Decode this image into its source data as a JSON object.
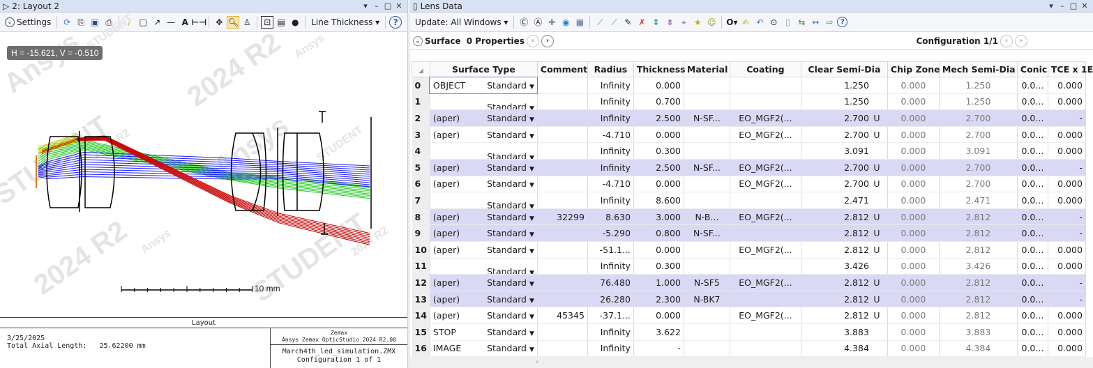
{
  "left_window": {
    "title": "2: Layout 2",
    "settings_label": "Settings",
    "line_thickness_label": "Line Thickness",
    "coord_readout": "H = -15.621, V = -0.510",
    "scale_label": "10 mm",
    "watermark_words": [
      "Ansys",
      "STUDENT",
      "2024 R2"
    ],
    "footer": {
      "title": "Layout",
      "date": "3/25/2025",
      "axial_length": "Total Axial Length:   25.62200 mm",
      "brand_line1": "Zemax",
      "brand_line2": "Ansys Zemax OpticStudio 2024 R2.00",
      "filename": "March4th_led_simulation.ZMX",
      "configuration": "Configuration 1 of 1"
    }
  },
  "right_window": {
    "title": "Lens Data",
    "update_label": "Update: All Windows",
    "surface_label": "Surface",
    "properties_label": "0 Properties",
    "configuration_label": "Configuration 1/1",
    "columns": [
      "",
      "Surface Type",
      "Comment",
      "Radius",
      "Thickness",
      "Material",
      "Coating",
      "Clear Semi-Dia",
      "Chip Zone",
      "Mech Semi-Dia",
      "Conic",
      "TCE x 1E"
    ],
    "rows": [
      {
        "idx": "0",
        "name": "OBJECT",
        "type": "Standard",
        "comment": "",
        "radius": "Infinity",
        "thickness": "0.000",
        "material": "",
        "coating": "",
        "clear": "1.250",
        "u": "",
        "chip": "0.000",
        "mech": "1.250",
        "conic": "0.0...",
        "tce": "0.000",
        "alt": false
      },
      {
        "idx": "1",
        "name": "",
        "type": "Standard",
        "comment": "",
        "radius": "Infinity",
        "thickness": "0.700",
        "material": "",
        "coating": "",
        "clear": "1.250",
        "u": "",
        "chip": "0.000",
        "mech": "1.250",
        "conic": "0.0...",
        "tce": "0.000",
        "alt": false
      },
      {
        "idx": "2",
        "name": "(aper)",
        "type": "Standard",
        "comment": "",
        "radius": "Infinity",
        "thickness": "2.500",
        "material": "N-SF...",
        "coating": "EO_MGF2(...",
        "clear": "2.700",
        "u": "U",
        "chip": "0.000",
        "mech": "2.700",
        "conic": "0.0...",
        "tce": "-",
        "alt": true
      },
      {
        "idx": "3",
        "name": "(aper)",
        "type": "Standard",
        "comment": "",
        "radius": "-4.710",
        "thickness": "0.000",
        "material": "",
        "coating": "EO_MGF2(...",
        "clear": "2.700",
        "u": "U",
        "chip": "0.000",
        "mech": "2.700",
        "conic": "0.0...",
        "tce": "0.000",
        "alt": false
      },
      {
        "idx": "4",
        "name": "",
        "type": "Standard",
        "comment": "",
        "radius": "Infinity",
        "thickness": "0.300",
        "material": "",
        "coating": "",
        "clear": "3.091",
        "u": "",
        "chip": "0.000",
        "mech": "3.091",
        "conic": "0.0...",
        "tce": "0.000",
        "alt": false
      },
      {
        "idx": "5",
        "name": "(aper)",
        "type": "Standard",
        "comment": "",
        "radius": "Infinity",
        "thickness": "2.500",
        "material": "N-SF...",
        "coating": "EO_MGF2(...",
        "clear": "2.700",
        "u": "U",
        "chip": "0.000",
        "mech": "2.700",
        "conic": "0.0...",
        "tce": "-",
        "alt": true
      },
      {
        "idx": "6",
        "name": "(aper)",
        "type": "Standard",
        "comment": "",
        "radius": "-4.710",
        "thickness": "0.000",
        "material": "",
        "coating": "EO_MGF2(...",
        "clear": "2.700",
        "u": "U",
        "chip": "0.000",
        "mech": "2.700",
        "conic": "0.0...",
        "tce": "0.000",
        "alt": false
      },
      {
        "idx": "7",
        "name": "",
        "type": "Standard",
        "comment": "",
        "radius": "Infinity",
        "thickness": "8.600",
        "material": "",
        "coating": "",
        "clear": "2.471",
        "u": "",
        "chip": "0.000",
        "mech": "2.471",
        "conic": "0.0...",
        "tce": "0.000",
        "alt": false
      },
      {
        "idx": "8",
        "name": "(aper)",
        "type": "Standard",
        "comment": "32299",
        "radius": "8.630",
        "thickness": "3.000",
        "material": "N-B...",
        "coating": "EO_MGF2(...",
        "clear": "2.812",
        "u": "U",
        "chip": "0.000",
        "mech": "2.812",
        "conic": "0.0...",
        "tce": "-",
        "alt": true
      },
      {
        "idx": "9",
        "name": "(aper)",
        "type": "Standard",
        "comment": "",
        "radius": "-5.290",
        "thickness": "0.800",
        "material": "N-SF...",
        "coating": "",
        "clear": "2.812",
        "u": "U",
        "chip": "0.000",
        "mech": "2.812",
        "conic": "0.0...",
        "tce": "-",
        "alt": true
      },
      {
        "idx": "10",
        "name": "(aper)",
        "type": "Standard",
        "comment": "",
        "radius": "-51.1...",
        "thickness": "0.000",
        "material": "",
        "coating": "EO_MGF2(...",
        "clear": "2.812",
        "u": "U",
        "chip": "0.000",
        "mech": "2.812",
        "conic": "0.0...",
        "tce": "0.000",
        "alt": false
      },
      {
        "idx": "11",
        "name": "",
        "type": "Standard",
        "comment": "",
        "radius": "Infinity",
        "thickness": "0.300",
        "material": "",
        "coating": "",
        "clear": "3.426",
        "u": "",
        "chip": "0.000",
        "mech": "3.426",
        "conic": "0.0...",
        "tce": "0.000",
        "alt": false
      },
      {
        "idx": "12",
        "name": "(aper)",
        "type": "Standard",
        "comment": "",
        "radius": "76.480",
        "thickness": "1.000",
        "material": "N-SF5",
        "coating": "EO_MGF2(...",
        "clear": "2.812",
        "u": "U",
        "chip": "0.000",
        "mech": "2.812",
        "conic": "0.0...",
        "tce": "-",
        "alt": true
      },
      {
        "idx": "13",
        "name": "(aper)",
        "type": "Standard",
        "comment": "",
        "radius": "26.280",
        "thickness": "2.300",
        "material": "N-BK7",
        "coating": "",
        "clear": "2.812",
        "u": "U",
        "chip": "0.000",
        "mech": "2.812",
        "conic": "0.0...",
        "tce": "-",
        "alt": true
      },
      {
        "idx": "14",
        "name": "(aper)",
        "type": "Standard",
        "comment": "45345",
        "radius": "-37.1...",
        "thickness": "0.000",
        "material": "",
        "coating": "EO_MGF2(...",
        "clear": "2.812",
        "u": "U",
        "chip": "0.000",
        "mech": "2.812",
        "conic": "0.0...",
        "tce": "0.000",
        "alt": false
      },
      {
        "idx": "15",
        "name": "STOP",
        "type": "Standard",
        "comment": "",
        "radius": "Infinity",
        "thickness": "3.622",
        "material": "",
        "coating": "",
        "clear": "3.883",
        "u": "",
        "chip": "0.000",
        "mech": "3.883",
        "conic": "0.0...",
        "tce": "0.000",
        "alt": false
      },
      {
        "idx": "16",
        "name": "IMAGE",
        "type": "Standard",
        "comment": "",
        "radius": "Infinity",
        "thickness": "-",
        "material": "",
        "coating": "",
        "clear": "4.384",
        "u": "",
        "chip": "0.000",
        "mech": "4.384",
        "conic": "0.0...",
        "tce": "0.000",
        "alt": false
      }
    ]
  },
  "colors": {
    "ray_red": "#cc0000",
    "ray_green": "#22cc22",
    "ray_blue": "#1a1aff",
    "ray_yellow": "#c8c800",
    "row_highlight": "#d9d9f5"
  }
}
